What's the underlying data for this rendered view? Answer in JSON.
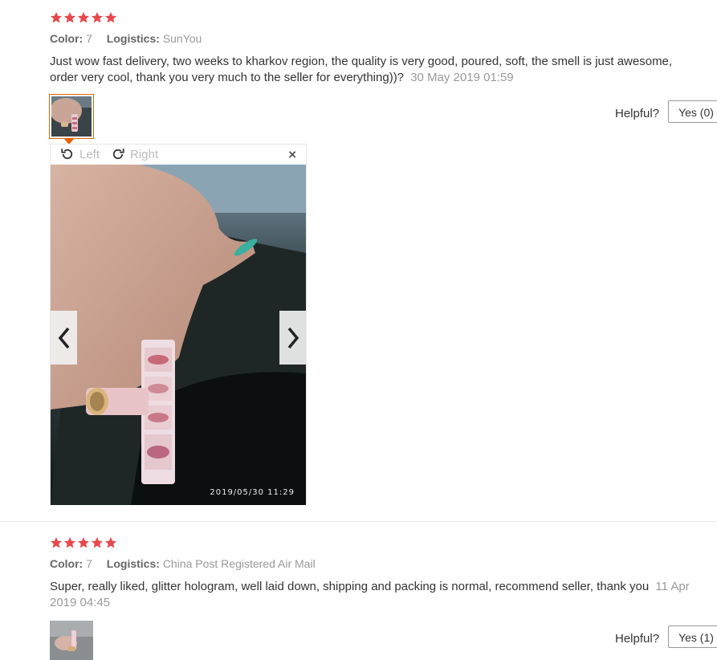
{
  "reviews": [
    {
      "rating": 5,
      "color_label": "Color:",
      "color_value": "7",
      "logistics_label": "Logistics:",
      "logistics_value": "SunYou",
      "text": "Just wow fast delivery, two weeks to kharkov region, the quality is very good, poured, soft, the smell is just awesome, order very cool, thank you very much to the seller for everything))?",
      "date": "30 May 2019 01:59",
      "helpful_label": "Helpful?",
      "yes_label": "Yes (0)"
    },
    {
      "rating": 5,
      "color_label": "Color:",
      "color_value": "7",
      "logistics_label": "Logistics:",
      "logistics_value": "China Post Registered Air Mail",
      "text": "Super, really liked, glitter hologram, well laid down, shipping and packing is normal, recommend seller, thank you",
      "date": "11 Apr 2019 04:45",
      "helpful_label": "Helpful?",
      "yes_label": "Yes (1)"
    }
  ],
  "viewer": {
    "rotate_left_label": "Left",
    "rotate_right_label": "Right",
    "close_glyph": "×",
    "photo_timestamp": "2019/05/30  11:29"
  },
  "colors": {
    "star": "#e5484d",
    "accent_border": "#e66000",
    "muted_text": "#999999",
    "text": "#333333"
  },
  "icons": {
    "star": "star-icon",
    "rotate_left": "rotate-left-icon",
    "rotate_right": "rotate-right-icon",
    "close": "close-icon",
    "prev": "chevron-left-icon",
    "next": "chevron-right-icon"
  }
}
